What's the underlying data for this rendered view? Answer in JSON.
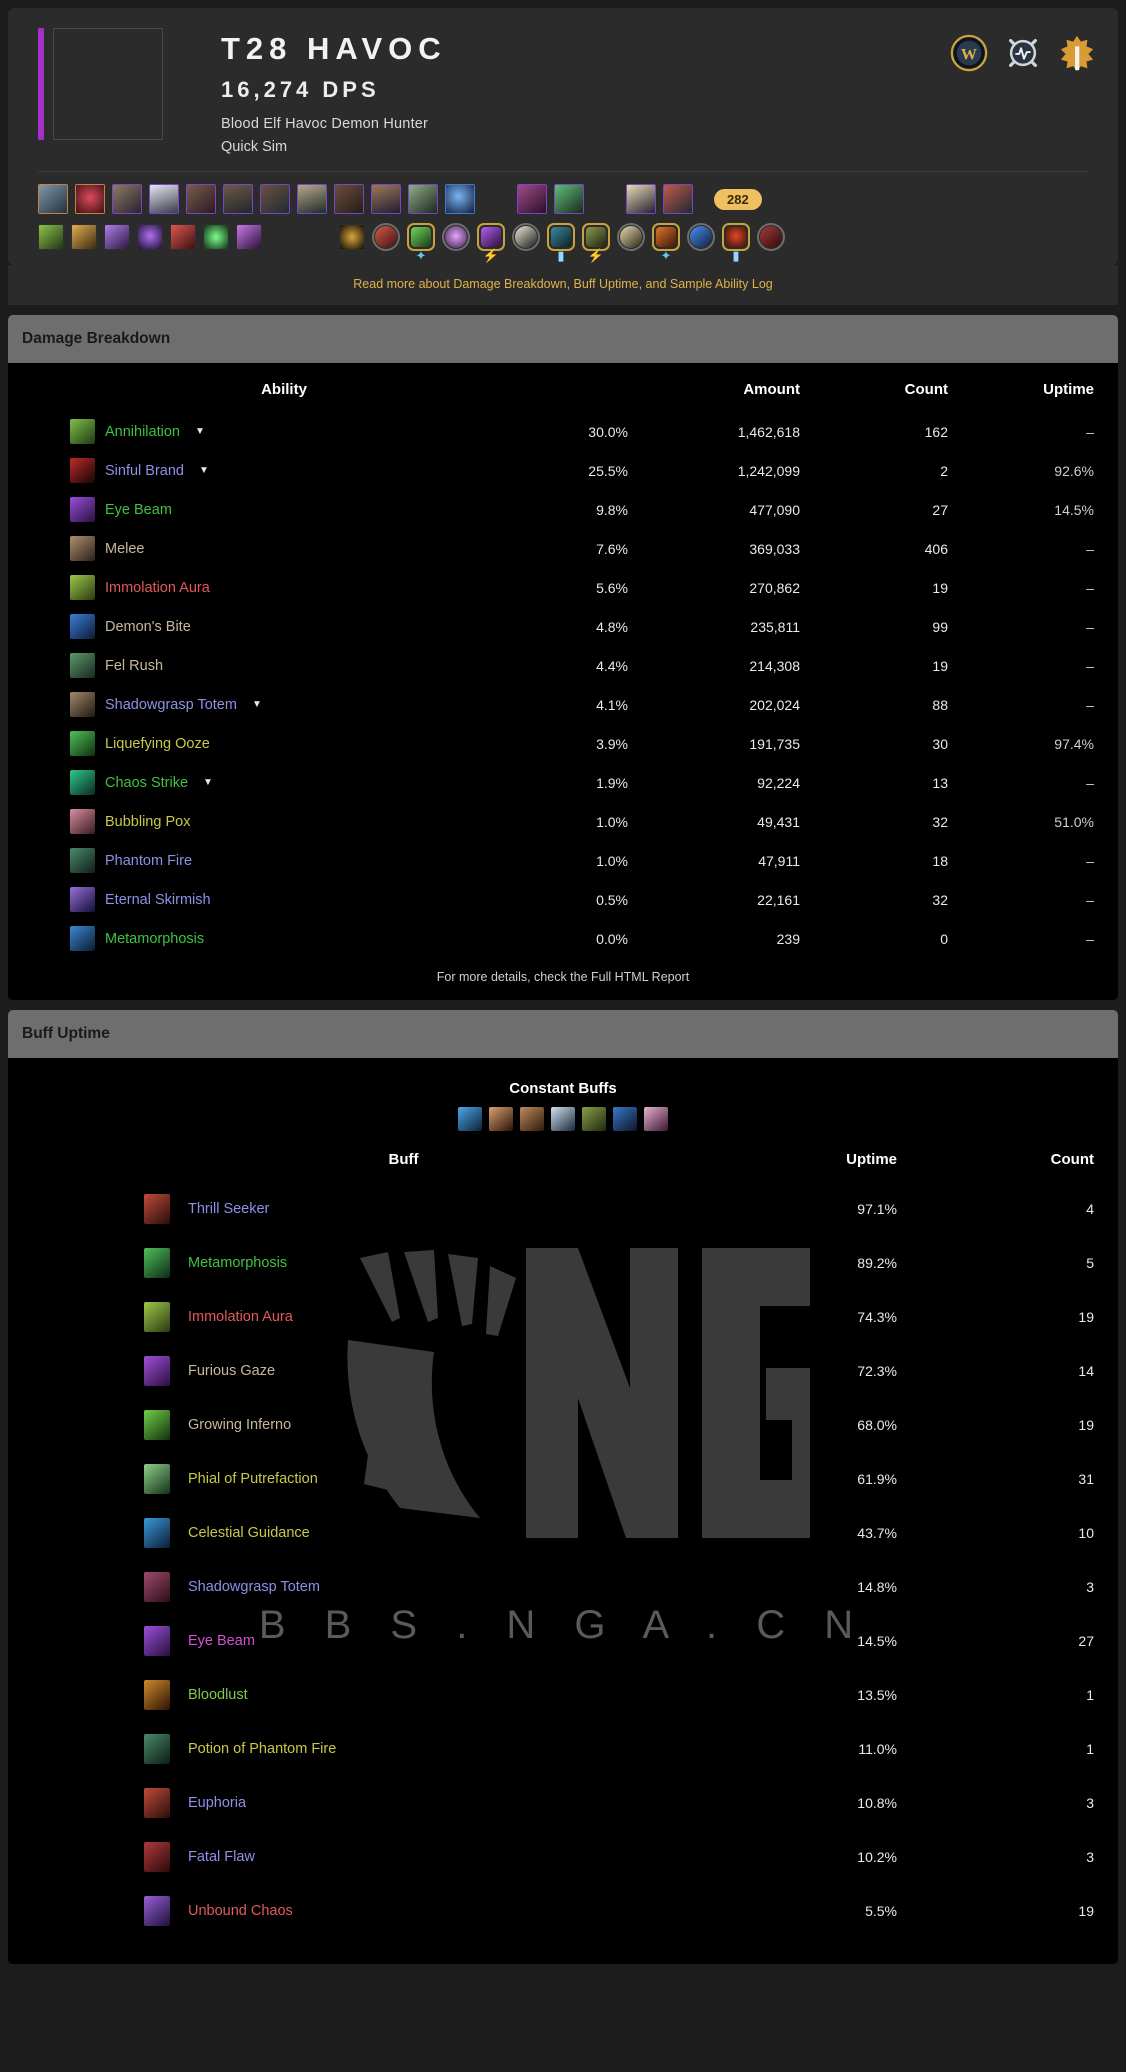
{
  "header": {
    "title": "T28 HAVOC",
    "dps": "16,274 DPS",
    "spec": "Blood Elf Havoc Demon Hunter",
    "mode": "Quick Sim",
    "class_color": "#a330c9",
    "icons": [
      {
        "name": "wow-logo-icon",
        "label": "W"
      },
      {
        "name": "raidbots-icon",
        "label": "Raidbots"
      },
      {
        "name": "wowhead-icon",
        "label": "Wowhead"
      }
    ],
    "item_level_badge": "282"
  },
  "gear": {
    "row1": [
      {
        "name": "head-slot-item",
        "quality": "legendary",
        "c1": "#7e98ad",
        "c2": "#223240"
      },
      {
        "name": "neck-slot-item",
        "quality": "legendary",
        "c1": "#b3354a",
        "c2": "#3a1016"
      },
      {
        "name": "shoulder-slot-item",
        "quality": "epic",
        "c1": "#8d7a63",
        "c2": "#2a2232"
      },
      {
        "name": "back-slot-item",
        "quality": "epic",
        "c1": "#cfd4da",
        "c2": "#2a2232"
      },
      {
        "name": "chest-slot-item",
        "quality": "epic",
        "c1": "#7a5c4a",
        "c2": "#2a1a22"
      },
      {
        "name": "wrist-slot-item",
        "quality": "epic",
        "c1": "#6d5948",
        "c2": "#20262a"
      },
      {
        "name": "hands-slot-item",
        "quality": "epic",
        "c1": "#6a5240",
        "c2": "#1f2b31"
      },
      {
        "name": "waist-slot-item",
        "quality": "epic",
        "c1": "#b9a88a",
        "c2": "#1d2c2a"
      },
      {
        "name": "legs-slot-item",
        "quality": "epic",
        "c1": "#6b4f3c",
        "c2": "#241c18"
      },
      {
        "name": "feet-slot-item",
        "quality": "epic",
        "c1": "#9a7a58",
        "c2": "#231c30"
      },
      {
        "name": "ring1-slot-item",
        "quality": "epic",
        "c1": "#6f8a6a",
        "c2": "#1d2820"
      },
      {
        "name": "ring2-slot-item",
        "quality": "rare",
        "c1": "#3a6fd0",
        "c2": "#121a38"
      }
    ],
    "row1b": [
      {
        "name": "trinket1-slot-item",
        "quality": "epic",
        "c1": "#7a3b6a",
        "c2": "#2a1028"
      },
      {
        "name": "trinket2-slot-item",
        "quality": "epic",
        "c1": "#3f8f5a",
        "c2": "#1a2a1c"
      }
    ],
    "row1c": [
      {
        "name": "mainhand-slot-item",
        "quality": "epic",
        "c1": "#d8cba0",
        "c2": "#232030"
      },
      {
        "name": "offhand-slot-item",
        "quality": "epic",
        "c1": "#8d3f3a",
        "c2": "#1e2832"
      }
    ],
    "row2_enchants": [
      {
        "name": "flask-consumable-icon",
        "c1": "#6fa33c",
        "c2": "#223514"
      },
      {
        "name": "food-consumable-icon",
        "c1": "#c99a3c",
        "c2": "#3a2a12"
      },
      {
        "name": "rune-consumable-icon",
        "c1": "#9a5fd8",
        "c2": "#2a1840"
      },
      {
        "name": "potion-consumable-icon",
        "c1": "#7b3fd0",
        "c2": "#1a0e30"
      },
      {
        "name": "weapon-oil-icon",
        "c1": "#c6453f",
        "c2": "#3a110f"
      },
      {
        "name": "emerald-gem-icon",
        "c1": "#49d05a",
        "c2": "#0e2e14"
      },
      {
        "name": "soulbind-icon",
        "c1": "#b05cd6",
        "c2": "#2a0f36"
      }
    ],
    "row2_buffs": [
      {
        "name": "covenant-sigil-icon",
        "shape": "sq",
        "c1": "#c8a23c",
        "c2": "#100a04"
      },
      {
        "name": "battle-shout-buff-icon",
        "shape": "grey",
        "c1": "#c04a3a",
        "c2": "#3a1210"
      },
      {
        "name": "mark-of-the-wild-buff-icon",
        "shape": "gold",
        "glyph": "sword",
        "c1": "#5fc04a",
        "c2": "#1c3a14"
      },
      {
        "name": "power-word-fortitude-buff-icon",
        "shape": "grey",
        "c1": "#c88fe8",
        "c2": "#3a1a4a"
      },
      {
        "name": "arcane-intellect-buff-icon",
        "shape": "gold",
        "glyph": "bolt",
        "c1": "#9a4fc8",
        "c2": "#2a1040"
      },
      {
        "name": "skyfury-totem-buff-icon",
        "shape": "grey",
        "c1": "#e8e0d0",
        "c2": "#1a1a1a"
      },
      {
        "name": "mystic-touch-debuff-icon",
        "shape": "gold",
        "glyph": "flask",
        "c1": "#2a6a7a",
        "c2": "#0c2028"
      },
      {
        "name": "chaos-brand-debuff-icon",
        "shape": "gold",
        "glyph": "bolt",
        "c1": "#6a7a3a",
        "c2": "#1e2410"
      },
      {
        "name": "bleed-debuff-icon",
        "shape": "grey",
        "c1": "#d8c8a0",
        "c2": "#2a2418"
      },
      {
        "name": "bloodlust-buff-icon",
        "shape": "gold",
        "glyph": "sword",
        "c1": "#c0602a",
        "c2": "#3a1608"
      },
      {
        "name": "windfury-buff-icon",
        "shape": "grey",
        "c1": "#3a78d8",
        "c2": "#0e1e3a"
      },
      {
        "name": "mortal-wounds-debuff-icon",
        "shape": "gold",
        "glyph": "flask",
        "c1": "#c03a2a",
        "c2": "#3a0e08"
      },
      {
        "name": "hunters-mark-debuff-icon",
        "shape": "grey",
        "c1": "#8a2a2a",
        "c2": "#2a0a0a"
      }
    ]
  },
  "readmore": "Read more about Damage Breakdown, Buff Uptime, and Sample Ability Log",
  "damage_panel": {
    "title": "Damage Breakdown",
    "columns": [
      "Ability",
      "Amount",
      "Count",
      "Uptime"
    ],
    "footer": "For more details, check the Full HTML Report",
    "rows": [
      {
        "ability": "Annihilation",
        "color": "#3fc33f",
        "has_caret": true,
        "pct": "30.0%",
        "amount": "1,462,618",
        "count": "162",
        "uptime": "–",
        "c1": "#7fc04a",
        "c2": "#1e3a12"
      },
      {
        "ability": "Sinful Brand",
        "color": "#8f8fe8",
        "has_caret": true,
        "pct": "25.5%",
        "amount": "1,242,099",
        "count": "2",
        "uptime": "92.6%",
        "c1": "#c02a2a",
        "c2": "#140404"
      },
      {
        "ability": "Eye Beam",
        "color": "#3fc33f",
        "has_caret": false,
        "pct": "9.8%",
        "amount": "477,090",
        "count": "27",
        "uptime": "14.5%",
        "c1": "#9a4fd8",
        "c2": "#2a1040"
      },
      {
        "ability": "Melee",
        "color": "#c8b89a",
        "has_caret": false,
        "pct": "7.6%",
        "amount": "369,033",
        "count": "406",
        "uptime": "–",
        "c1": "#b09070",
        "c2": "#2a2018"
      },
      {
        "ability": "Immolation Aura",
        "color": "#e05a5a",
        "has_caret": false,
        "pct": "5.6%",
        "amount": "270,862",
        "count": "19",
        "uptime": "–",
        "c1": "#9fc84a",
        "c2": "#2a3a10"
      },
      {
        "ability": "Demon's Bite",
        "color": "#c8b89a",
        "has_caret": false,
        "pct": "4.8%",
        "amount": "235,811",
        "count": "99",
        "uptime": "–",
        "c1": "#3a7fd8",
        "c2": "#0e1a38"
      },
      {
        "ability": "Fel Rush",
        "color": "#c8b89a",
        "has_caret": false,
        "pct": "4.4%",
        "amount": "214,308",
        "count": "19",
        "uptime": "–",
        "c1": "#5a9a6a",
        "c2": "#182820"
      },
      {
        "ability": "Shadowgrasp Totem",
        "color": "#8f8fe8",
        "has_caret": true,
        "pct": "4.1%",
        "amount": "202,024",
        "count": "88",
        "uptime": "–",
        "c1": "#a08a6a",
        "c2": "#201810"
      },
      {
        "ability": "Liquefying Ooze",
        "color": "#c8c84a",
        "has_caret": false,
        "pct": "3.9%",
        "amount": "191,735",
        "count": "30",
        "uptime": "97.4%",
        "c1": "#4fc05a",
        "c2": "#10300e"
      },
      {
        "ability": "Chaos Strike",
        "color": "#3fc33f",
        "has_caret": true,
        "pct": "1.9%",
        "amount": "92,224",
        "count": "13",
        "uptime": "–",
        "c1": "#2ec88f",
        "c2": "#0c2a20"
      },
      {
        "ability": "Bubbling Pox",
        "color": "#c8c84a",
        "has_caret": false,
        "pct": "1.0%",
        "amount": "49,431",
        "count": "32",
        "uptime": "51.0%",
        "c1": "#d88fa0",
        "c2": "#3a1a22"
      },
      {
        "ability": "Phantom Fire",
        "color": "#8f8fe8",
        "has_caret": false,
        "pct": "1.0%",
        "amount": "47,911",
        "count": "18",
        "uptime": "–",
        "c1": "#4a8a6a",
        "c2": "#101e18"
      },
      {
        "ability": "Eternal Skirmish",
        "color": "#8f8fe8",
        "has_caret": false,
        "pct": "0.5%",
        "amount": "22,161",
        "count": "32",
        "uptime": "–",
        "c1": "#9a6fd8",
        "c2": "#101038"
      },
      {
        "ability": "Metamorphosis",
        "color": "#3fc33f",
        "has_caret": false,
        "pct": "0.0%",
        "amount": "239",
        "count": "0",
        "uptime": "–",
        "c1": "#3a8ad0",
        "c2": "#0c1a30"
      }
    ]
  },
  "buff_panel": {
    "title": "Buff Uptime",
    "constant_buffs_label": "Constant Buffs",
    "constant_buffs": [
      {
        "name": "arcane-intellect-icon",
        "c1": "#4aa8e8",
        "c2": "#0c2038"
      },
      {
        "name": "battle-shout-icon",
        "c1": "#d8a070",
        "c2": "#2a1208"
      },
      {
        "name": "food-buff-icon",
        "c1": "#c08a5a",
        "c2": "#2a1a0e"
      },
      {
        "name": "power-word-fortitude-icon",
        "c1": "#cfe0f0",
        "c2": "#1a2838"
      },
      {
        "name": "mark-of-the-wild-icon",
        "c1": "#8aa04a",
        "c2": "#1e2810"
      },
      {
        "name": "skyfury-icon",
        "c1": "#3a78c8",
        "c2": "#0c1428"
      },
      {
        "name": "flask-buff-icon",
        "c1": "#e8b0d0",
        "c2": "#3a1830"
      }
    ],
    "columns": [
      "Buff",
      "Uptime",
      "Count"
    ],
    "rows": [
      {
        "buff": "Thrill Seeker",
        "color": "#8f8fe8",
        "uptime": "97.1%",
        "count": "4",
        "c1": "#c04a3a",
        "c2": "#2a0e0a"
      },
      {
        "buff": "Metamorphosis",
        "color": "#3fc33f",
        "uptime": "89.2%",
        "count": "5",
        "c1": "#4fc05a",
        "c2": "#0e2a14"
      },
      {
        "buff": "Immolation Aura",
        "color": "#e05a5a",
        "uptime": "74.3%",
        "count": "19",
        "c1": "#9fc84a",
        "c2": "#2a3a10"
      },
      {
        "buff": "Furious Gaze",
        "color": "#c8b89a",
        "uptime": "72.3%",
        "count": "14",
        "c1": "#a04fd8",
        "c2": "#2a1040"
      },
      {
        "buff": "Growing Inferno",
        "color": "#c8b89a",
        "uptime": "68.0%",
        "count": "19",
        "c1": "#6fd04a",
        "c2": "#14300c"
      },
      {
        "buff": "Phial of Putrefaction",
        "color": "#c8c84a",
        "uptime": "61.9%",
        "count": "31",
        "c1": "#8fd08a",
        "c2": "#16301a"
      },
      {
        "buff": "Celestial Guidance",
        "color": "#c8c84a",
        "uptime": "43.7%",
        "count": "10",
        "c1": "#3a9ad8",
        "c2": "#0c1c34"
      },
      {
        "buff": "Shadowgrasp Totem",
        "color": "#8f8fe8",
        "uptime": "14.8%",
        "count": "3",
        "c1": "#a04a6a",
        "c2": "#2a0e1a"
      },
      {
        "buff": "Eye Beam",
        "color": "#d050d0",
        "uptime": "14.5%",
        "count": "27",
        "c1": "#9a4fd8",
        "c2": "#2a1040"
      },
      {
        "buff": "Bloodlust",
        "color": "#7fc84a",
        "uptime": "13.5%",
        "count": "1",
        "c1": "#d08a2a",
        "c2": "#2a1404"
      },
      {
        "buff": "Potion of Phantom Fire",
        "color": "#c8c84a",
        "uptime": "11.0%",
        "count": "1",
        "c1": "#4a8a6a",
        "c2": "#0e1c16"
      },
      {
        "buff": "Euphoria",
        "color": "#8f8fe8",
        "uptime": "10.8%",
        "count": "3",
        "c1": "#c04a3a",
        "c2": "#2a0e0a"
      },
      {
        "buff": "Fatal Flaw",
        "color": "#8f8fe8",
        "uptime": "10.2%",
        "count": "3",
        "c1": "#b03a3a",
        "c2": "#2a0a0a"
      },
      {
        "buff": "Unbound Chaos",
        "color": "#e05a5a",
        "uptime": "5.5%",
        "count": "19",
        "c1": "#9a5fd8",
        "c2": "#1c1038"
      }
    ]
  },
  "watermark": {
    "text": "B B S . N G A . C N",
    "logo_text": "NGA"
  }
}
